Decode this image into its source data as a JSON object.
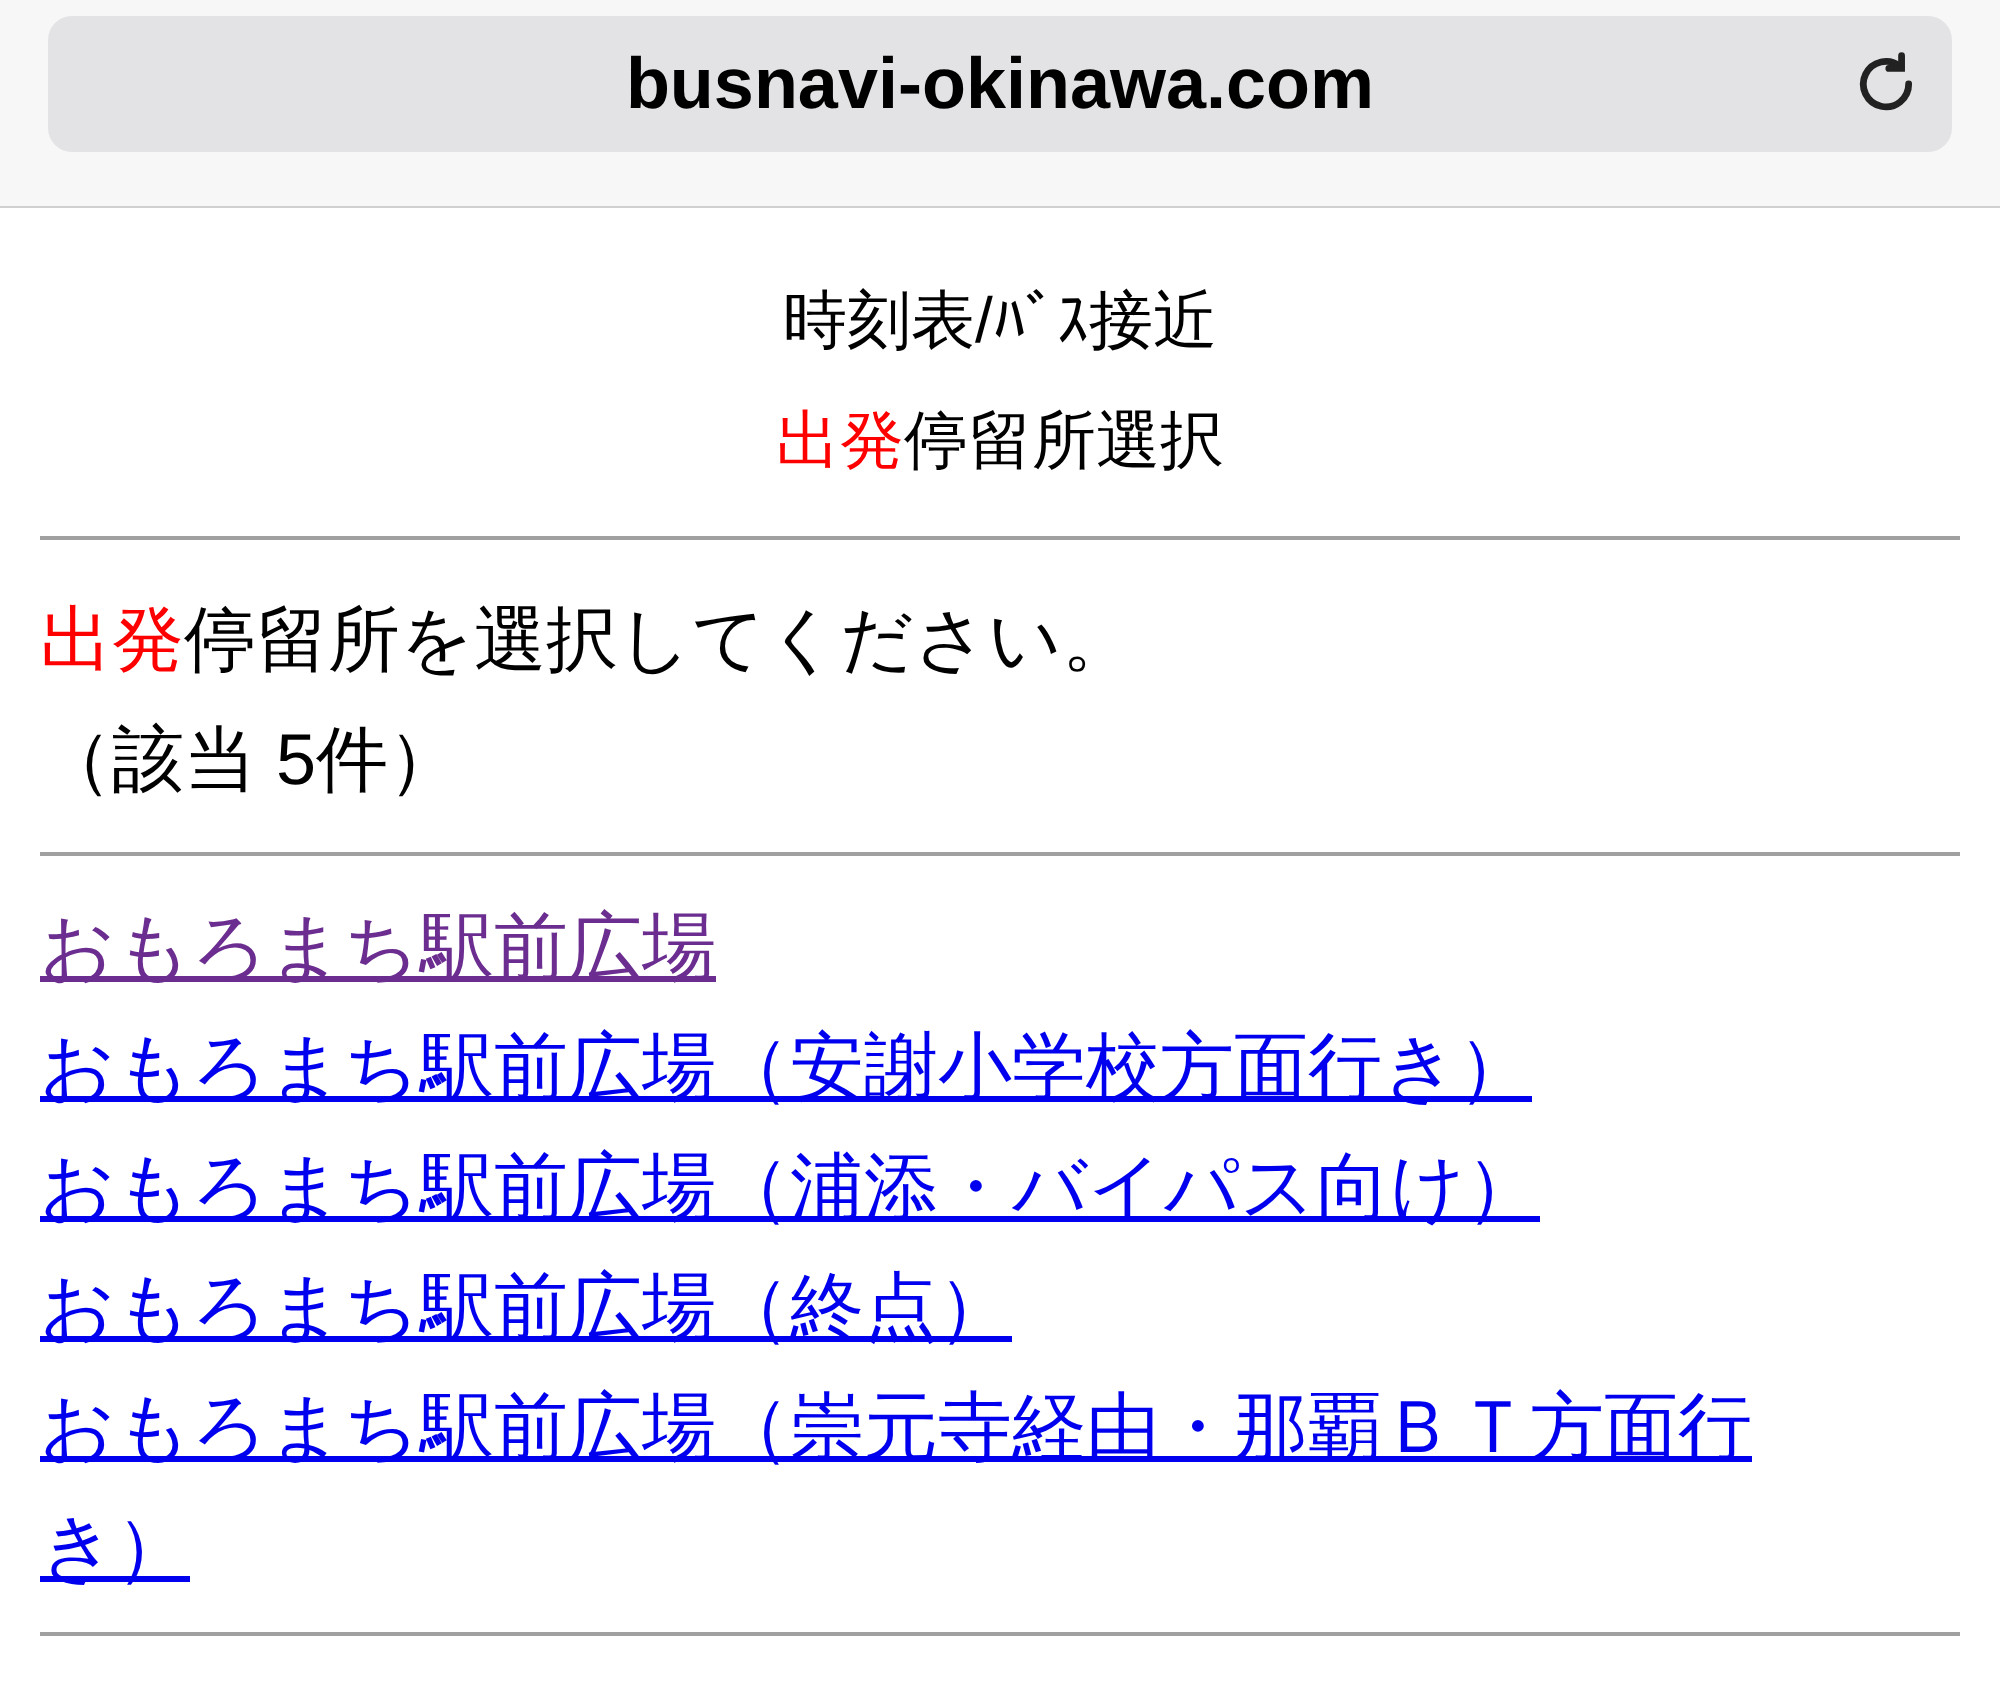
{
  "address_bar": {
    "url": "busnavi-okinawa.com"
  },
  "header": {
    "title": "時刻表/ﾊﾞｽ接近",
    "subtitle": {
      "highlight": "出発",
      "rest": "停留所選択"
    }
  },
  "message": {
    "highlight": "出発",
    "rest": "停留所を選択してください。",
    "count": "（該当 5件）"
  },
  "stops": [
    {
      "label": "おもろまち駅前広場",
      "visited": true
    },
    {
      "label": "おもろまち駅前広場（安謝小学校方面行き）",
      "visited": false
    },
    {
      "label": "おもろまち駅前広場（浦添・バイパス向け）",
      "visited": false
    },
    {
      "label": "おもろまち駅前広場（終点）",
      "visited": false
    },
    {
      "label": "おもろまち駅前広場（崇元寺経由・那覇ＢＴ方面行き）",
      "visited": false
    }
  ]
}
